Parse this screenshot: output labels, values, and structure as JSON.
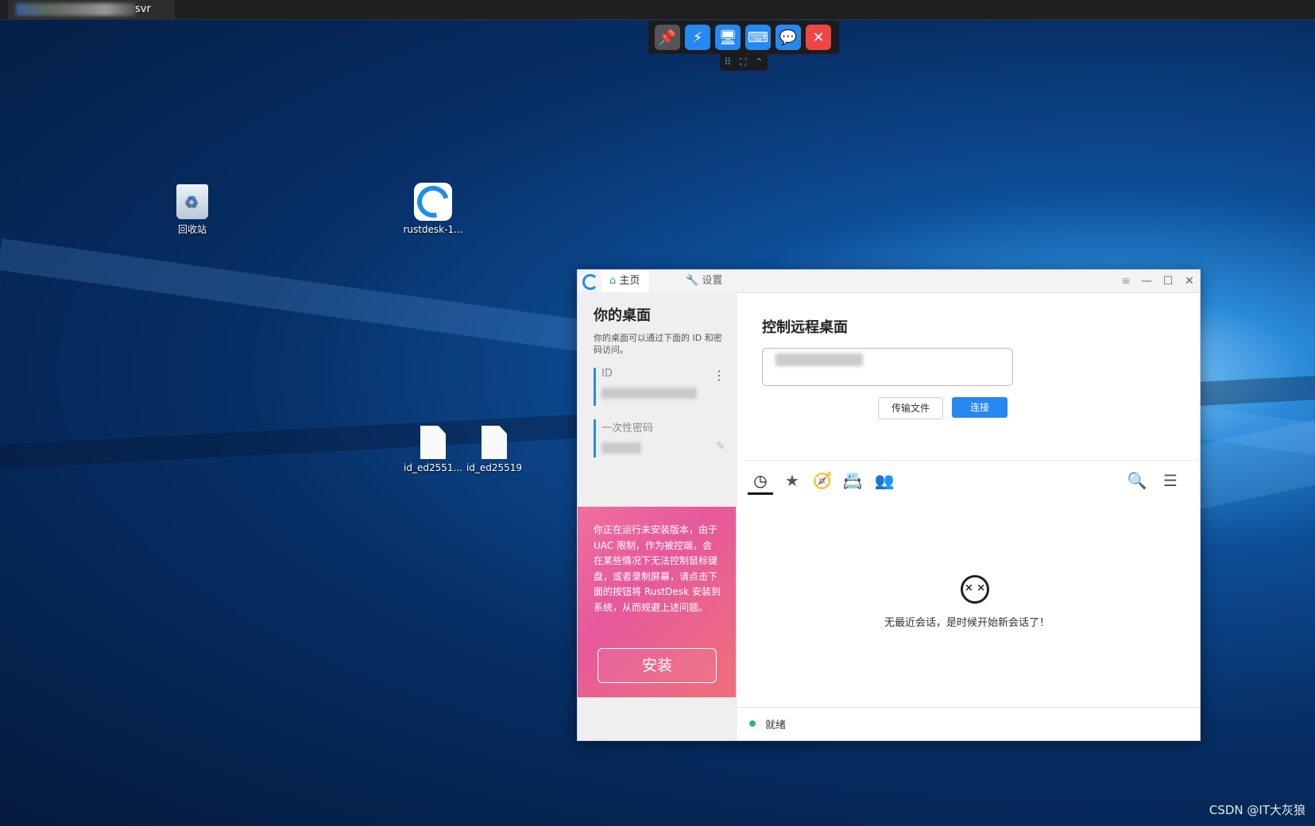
{
  "desktop": {
    "icons": [
      {
        "label": "回收站"
      },
      {
        "label": "rustdesk-1..."
      },
      {
        "label": "id_ed2551..."
      },
      {
        "label": "id_ed25519"
      }
    ],
    "watermark": "CSDN @IT大灰狼"
  },
  "host_tab": {
    "title_suffix": "svr"
  },
  "remote_toolbar": {
    "buttons": [
      "pin-icon",
      "lightning-icon",
      "monitor-icon",
      "keyboard-icon",
      "chat-icon",
      "close-icon"
    ],
    "colors": {
      "pin": "#555555",
      "blue": "#2688f0",
      "close": "#f04545"
    }
  },
  "app": {
    "tabs": {
      "home": "主页",
      "settings": "设置"
    },
    "left": {
      "title": "你的桌面",
      "description": "你的桌面可以通过下面的 ID 和密码访问。",
      "id_label": "ID",
      "password_label": "一次性密码"
    },
    "warning": {
      "text": "你正在运行未安装版本，由于 UAC 限制，作为被控端，会在某些情况下无法控制鼠标键盘，或者录制屏幕，请点击下面的按钮将 RustDesk 安装到系统，从而规避上述问题。",
      "install_button": "安装"
    },
    "remote": {
      "title": "控制远程桌面",
      "transfer_button": "传输文件",
      "connect_button": "连接"
    },
    "empty_message": "无最近会话，是时候开始新会话了！",
    "status": "就绪",
    "accent_color": "#2688f0"
  }
}
